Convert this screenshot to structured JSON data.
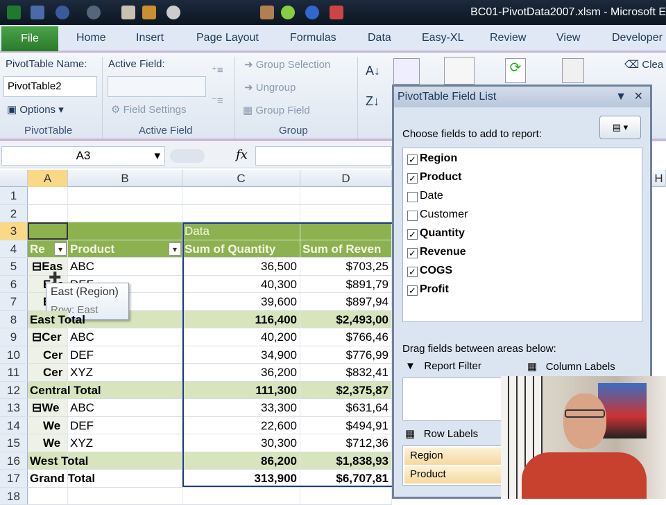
{
  "window": {
    "title": "BC01-PivotData2007.xlsm - Microsoft E"
  },
  "tabs": [
    "File",
    "Home",
    "Insert",
    "Page Layout",
    "Formulas",
    "Data",
    "Easy-XL",
    "Review",
    "View",
    "Developer"
  ],
  "ribbon": {
    "pivot_name_label": "PivotTable Name:",
    "pivot_name_value": "PivotTable2",
    "options": "Options",
    "group_pivot": "PivotTable",
    "active_field_label": "Active Field:",
    "field_settings": "Field Settings",
    "group_active": "Active Field",
    "group_selection": "Group Selection",
    "ungroup": "Ungroup",
    "group_field": "Group Field",
    "group_group": "Group",
    "clear": "Clea"
  },
  "formula_bar": {
    "name_box": "A3",
    "fx": "fx",
    "value": ""
  },
  "columns": [
    "A",
    "B",
    "C",
    "D",
    "H"
  ],
  "rows": [
    {
      "n": "1",
      "a": "",
      "b": "",
      "c": "",
      "d": "",
      "type": "blank"
    },
    {
      "n": "2",
      "a": "",
      "b": "",
      "c": "",
      "d": "",
      "type": "blank"
    },
    {
      "n": "3",
      "a": "",
      "b": "",
      "c": "Data",
      "d": "",
      "type": "hdr"
    },
    {
      "n": "4",
      "a": "Re",
      "b": "Product",
      "c": "Sum of Quantity",
      "d": "Sum of Reven",
      "type": "hdr"
    },
    {
      "n": "5",
      "a": "⊟Eas",
      "b": "ABC",
      "c": "36,500",
      "d": "$703,25",
      "type": "data"
    },
    {
      "n": "6",
      "a": "Eas",
      "b": "DEF",
      "c": "40,300",
      "d": "$891,79",
      "type": "data"
    },
    {
      "n": "7",
      "a": "Eas",
      "b": "XYZ",
      "c": "39,600",
      "d": "$897,94",
      "type": "data"
    },
    {
      "n": "8",
      "a": "East Total",
      "b": "",
      "c": "116,400",
      "d": "$2,493,00",
      "type": "total"
    },
    {
      "n": "9",
      "a": "⊟Cer",
      "b": "ABC",
      "c": "40,200",
      "d": "$766,46",
      "type": "data"
    },
    {
      "n": "10",
      "a": "Cer",
      "b": "DEF",
      "c": "34,900",
      "d": "$776,99",
      "type": "data"
    },
    {
      "n": "11",
      "a": "Cer",
      "b": "XYZ",
      "c": "36,200",
      "d": "$832,41",
      "type": "data"
    },
    {
      "n": "12",
      "a": "Central Total",
      "b": "",
      "c": "111,300",
      "d": "$2,375,87",
      "type": "total"
    },
    {
      "n": "13",
      "a": "⊟We",
      "b": "ABC",
      "c": "33,300",
      "d": "$631,64",
      "type": "data"
    },
    {
      "n": "14",
      "a": "We",
      "b": "DEF",
      "c": "22,600",
      "d": "$494,91",
      "type": "data"
    },
    {
      "n": "15",
      "a": "We",
      "b": "XYZ",
      "c": "30,300",
      "d": "$712,36",
      "type": "data"
    },
    {
      "n": "16",
      "a": "West Total",
      "b": "",
      "c": "86,200",
      "d": "$1,838,93",
      "type": "total"
    },
    {
      "n": "17",
      "a": "Grand Total",
      "b": "",
      "c": "313,900",
      "d": "$6,707,81",
      "type": "grand"
    },
    {
      "n": "18",
      "a": "",
      "b": "",
      "c": "",
      "d": "",
      "type": "blank"
    }
  ],
  "tooltip": {
    "title": "East (Region)",
    "sub": "Row: East"
  },
  "field_list": {
    "title": "PivotTable Field List",
    "choose": "Choose fields to add to report:",
    "fields": [
      {
        "name": "Region",
        "checked": true
      },
      {
        "name": "Product",
        "checked": true
      },
      {
        "name": "Date",
        "checked": false
      },
      {
        "name": "Customer",
        "checked": false
      },
      {
        "name": "Quantity",
        "checked": true
      },
      {
        "name": "Revenue",
        "checked": true
      },
      {
        "name": "COGS",
        "checked": true
      },
      {
        "name": "Profit",
        "checked": true
      }
    ],
    "drag": "Drag fields between areas below:",
    "report_filter": "Report Filter",
    "column_labels": "Column Labels",
    "row_labels": "Row Labels",
    "row_items": [
      "Region",
      "Product"
    ]
  }
}
